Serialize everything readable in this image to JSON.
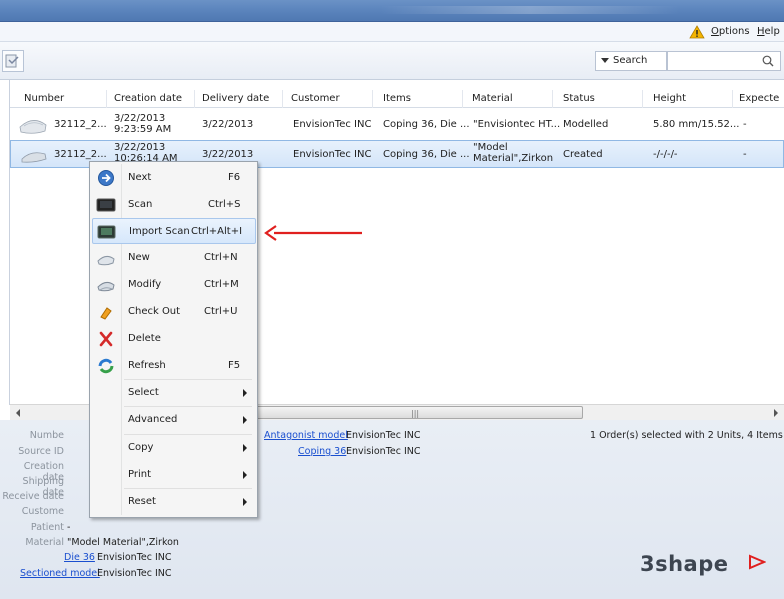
{
  "menubar": {
    "options": "Options",
    "options_key": "O",
    "options_rest": "ptions",
    "help": "Help",
    "help_key": "H",
    "help_rest": "elp"
  },
  "toolbar": {
    "filter_label": "Search",
    "search_placeholder": ""
  },
  "grid": {
    "columns": [
      "Number",
      "Creation date",
      "Delivery date",
      "Customer",
      "Items",
      "Material",
      "Status",
      "Height",
      "Expecte"
    ],
    "rows": [
      {
        "number": "32112_2...",
        "created_date": "3/22/2013",
        "created_time": "9:23:59 AM",
        "delivery": "3/22/2013",
        "customer": "EnvisionTec INC",
        "items": "Coping 36, Die ...",
        "material": "\"Envisiontec HT...",
        "material2": "",
        "status": "Modelled",
        "height": "5.80 mm/15.52...",
        "expected": "-"
      },
      {
        "number": "32112_2...",
        "created_date": "3/22/2013",
        "created_time": "10:26:14 AM",
        "delivery": "3/22/2013",
        "customer": "EnvisionTec INC",
        "items": "Coping 36, Die ...",
        "material": "\"Model",
        "material2": "Material\",Zirkon",
        "status": "Created",
        "height": "-/-/-/-",
        "expected": "-"
      }
    ]
  },
  "context_menu": [
    {
      "label": "Next",
      "shortcut": "F6",
      "icon": "next-arrow-icon"
    },
    {
      "label": "Scan",
      "shortcut": "Ctrl+S",
      "icon": "scanner-icon"
    },
    {
      "label": "Import Scan",
      "shortcut": "Ctrl+Alt+I",
      "icon": "import-scan-icon"
    },
    {
      "label": "New",
      "shortcut": "Ctrl+N",
      "icon": "new-order-icon"
    },
    {
      "label": "Modify",
      "shortcut": "Ctrl+M",
      "icon": "modify-icon"
    },
    {
      "label": "Check Out",
      "shortcut": "Ctrl+U",
      "icon": "check-out-icon"
    },
    {
      "label": "Delete",
      "shortcut": "",
      "icon": "delete-icon"
    },
    {
      "label": "Refresh",
      "shortcut": "F5",
      "icon": "refresh-icon"
    },
    {
      "label": "Select",
      "shortcut": "",
      "icon": ""
    },
    {
      "label": "Advanced",
      "shortcut": "",
      "icon": ""
    },
    {
      "label": "Copy",
      "shortcut": "",
      "icon": ""
    },
    {
      "label": "Print",
      "shortcut": "",
      "icon": ""
    },
    {
      "label": "Reset",
      "shortcut": "",
      "icon": ""
    }
  ],
  "details": {
    "labels": [
      "Numbe",
      "Source ID",
      "Creation date",
      "Shipping date",
      "Receive date",
      "Custome",
      "Patient",
      "Material"
    ],
    "patient_value": "-",
    "material_value": "\"Model Material\",Zirkon",
    "die_link": "Die 36",
    "die_value": "EnvisionTec INC",
    "sectioned_link": "Sectioned model",
    "sectioned_value": "EnvisionTec INC",
    "antagonist_link": "Antagonist model",
    "antagonist_value": "EnvisionTec INC",
    "coping_link": "Coping 36",
    "coping_value": "EnvisionTec INC",
    "summary": "1 Order(s) selected with 2 Units, 4 Items"
  },
  "brand": "3shape",
  "colors": {
    "accent_red": "#e0201f",
    "selection": "#d4e5f9",
    "link": "#1a4fcf"
  }
}
